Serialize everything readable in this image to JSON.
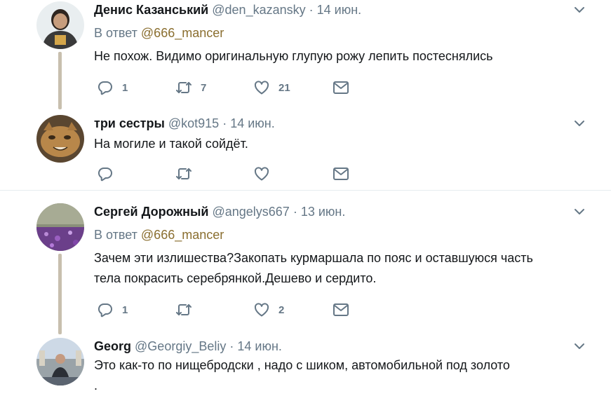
{
  "tweets": [
    {
      "name": "Денис Казанський",
      "handle": "@den_kazansky",
      "separator": "·",
      "date": "14 июн.",
      "reply_prefix": "В ответ",
      "reply_to": "@666_mancer",
      "text_lines": [
        "Не похож. Видимо оригинальную глупую рожу лепить постеснялись"
      ],
      "replies": "1",
      "retweets": "7",
      "likes": "21"
    },
    {
      "name": "три сестры",
      "handle": "@kot915",
      "separator": "·",
      "date": "14 июн.",
      "text_lines": [
        "На могиле и такой сойдёт."
      ]
    },
    {
      "name": "Сергей Дорожный",
      "handle": "@angelys667",
      "separator": "·",
      "date": "13 июн.",
      "reply_prefix": "В ответ",
      "reply_to": "@666_mancer",
      "text_lines": [
        "Зачем эти излишества?Закопать курмаршала по пояс и оставшуюся часть",
        "тела покрасить серебрянкой.Дешево и сердито."
      ],
      "replies": "1",
      "likes": "2"
    },
    {
      "name": "Georg",
      "handle": "@Georgiy_Beliy",
      "separator": "·",
      "date": "14 июн.",
      "text_lines": [
        "Это как-то по нищебродски , надо с шиком, автомобильной под золото",
        "."
      ]
    }
  ],
  "colors": {
    "muted": "#657786",
    "mention": "#8a6e2f",
    "thread_line": "#c8bfae",
    "separator": "#e6ecf0"
  },
  "icons": [
    "reply-icon",
    "retweet-icon",
    "like-icon",
    "message-icon",
    "chevron-down-icon"
  ]
}
